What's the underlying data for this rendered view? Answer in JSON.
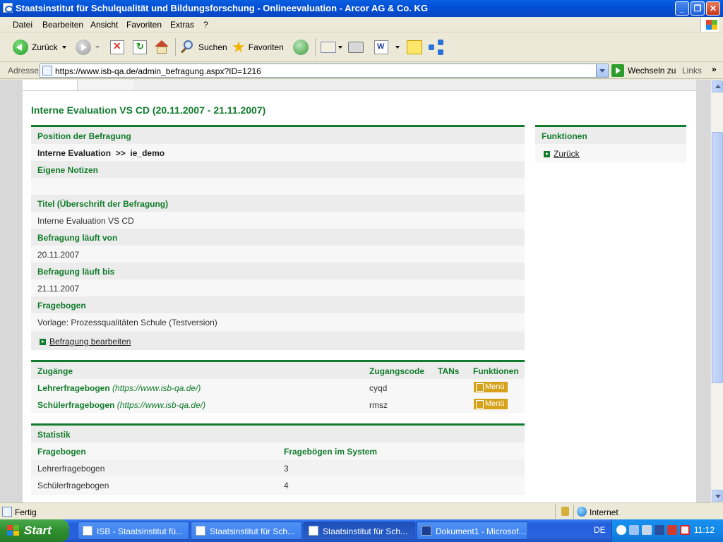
{
  "window": {
    "title": "Staatsinstitut für Schulqualität und Bildungsforschung - Onlineevaluation - Arcor AG & Co. KG",
    "buttons": [
      "_",
      "❐",
      "✕"
    ]
  },
  "menu": [
    "Datei",
    "Bearbeiten",
    "Ansicht",
    "Favoriten",
    "Extras",
    "?"
  ],
  "toolbar": {
    "back": "Zurück",
    "search": "Suchen",
    "favorites": "Favoriten"
  },
  "address": {
    "label": "Adresse",
    "url": "https://www.isb-qa.de/admin_befragung.aspx?ID=1216",
    "go": "Wechseln zu",
    "links": "Links",
    "links_more": "»"
  },
  "page": {
    "title": "Interne Evaluation VS CD (20.11.2007 - 21.11.2007)",
    "details": {
      "position_label": "Position der Befragung",
      "position_value_1": "Interne Evaluation",
      "position_sep": ">>",
      "position_value_2": "ie_demo",
      "notes_label": "Eigene Notizen",
      "notes_value": "",
      "titel_label": "Titel (Überschrift der Befragung)",
      "titel_value": "Interne Evaluation VS CD",
      "von_label": "Befragung läuft von",
      "von_value": "20.11.2007",
      "bis_label": "Befragung läuft bis",
      "bis_value": "21.11.2007",
      "fragebogen_label": "Fragebogen",
      "fragebogen_value": "Vorlage: Prozessqualitäten Schule (Testversion)",
      "edit_link": "Befragung bearbeiten"
    },
    "functions": {
      "header": "Funktionen",
      "back_link": "Zurück"
    },
    "access": {
      "headers": [
        "Zugänge",
        "Zugangscode",
        "TANs",
        "Funktionen"
      ],
      "rows": [
        {
          "name": "Lehrerfragebogen",
          "url": "(https://www.isb-qa.de/)",
          "code": "cyqd",
          "tans": "",
          "menu": "Menü"
        },
        {
          "name": "Schülerfragebogen",
          "url": "(https://www.isb-qa.de/)",
          "code": "rmsz",
          "tans": "",
          "menu": "Menü"
        }
      ]
    },
    "stats": {
      "header": "Statistik",
      "col1": "Fragebogen",
      "col2": "Fragebögen im System",
      "rows": [
        {
          "name": "Lehrerfragebogen",
          "count": "3"
        },
        {
          "name": "Schülerfragebogen",
          "count": "4"
        }
      ]
    }
  },
  "status": {
    "text": "Fertig",
    "zone": "Internet"
  },
  "taskbar": {
    "start": "Start",
    "tasks": [
      "ISB - Staatsinstitut fü...",
      "Staatsinstitut für Sch...",
      "Staatsinstitut für Sch...",
      "Dokument1 - Microsof..."
    ],
    "lang": "DE",
    "time": "11:12"
  }
}
